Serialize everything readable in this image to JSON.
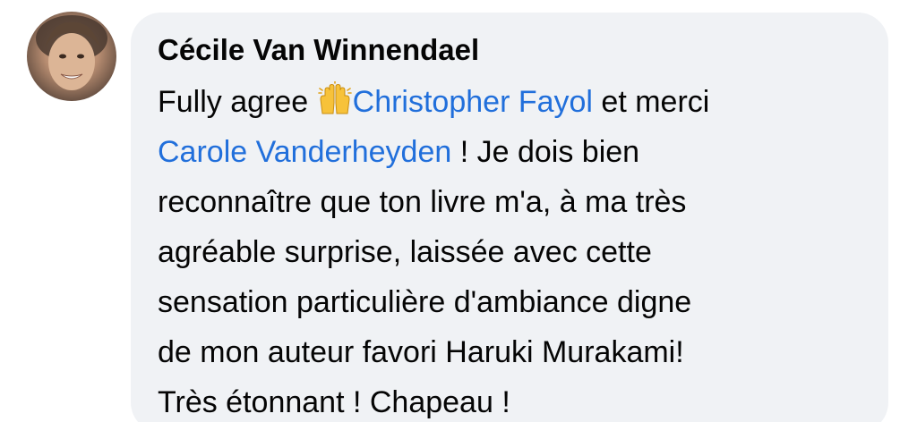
{
  "comment": {
    "author": "Cécile Van Winnendael",
    "avatar_icon": "profile-photo",
    "emoji_icon": "raising-hands-emoji",
    "lines": {
      "l1_a": "Fully agree ",
      "l1_mention": "Christopher Fayol",
      "l1_b": " et merci",
      "l2_mention": "Carole Vanderheyden",
      "l2_b": " ! Je dois bien",
      "l3": "reconnaître que ton livre m'a, à ma très",
      "l4": "agréable surprise, laissée avec cette",
      "l5": "sensation particulière d'ambiance digne",
      "l6": "de mon auteur favori Haruki Murakami!",
      "l7": "Très étonnant ! Chapeau !"
    },
    "colors": {
      "bubble": "#f0f2f5",
      "mention": "#216fdb",
      "text": "#050505"
    }
  }
}
